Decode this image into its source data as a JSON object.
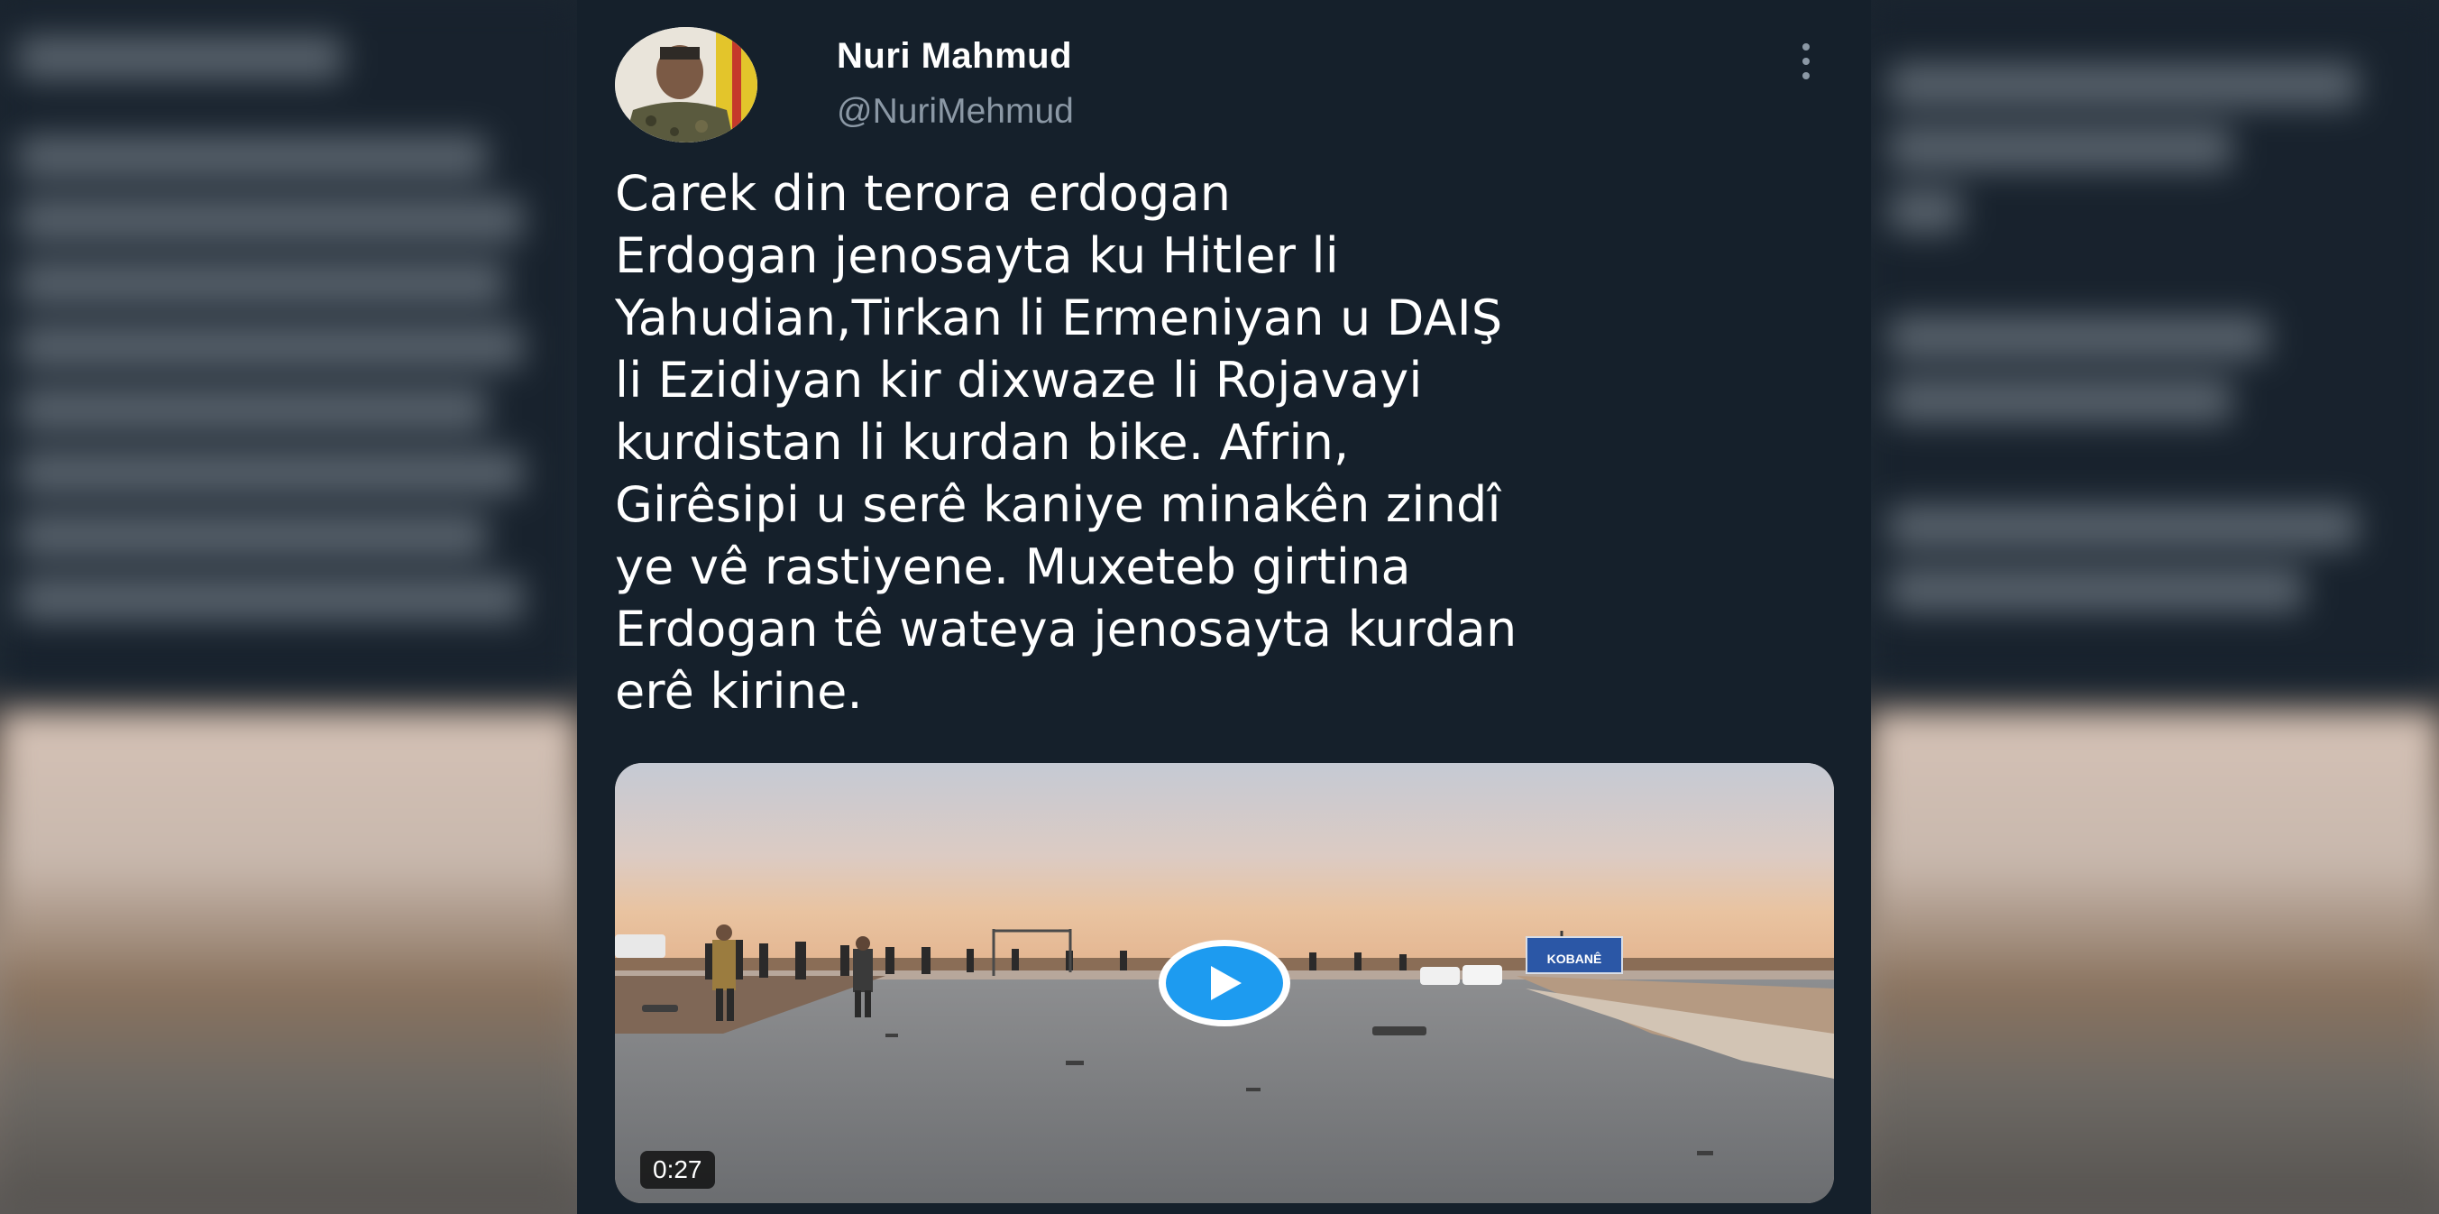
{
  "tweet": {
    "author": {
      "name": "Nuri Mahmud",
      "handle": "@NuriMehmud",
      "avatar_icon": "profile-photo"
    },
    "more_icon": "more-vertical-icon",
    "text": "Carek din terora erdogan\nErdogan jenosayta ku Hitler li\nYahudian,Tirkan li Ermeniyan u DAIŞ\nli Ezidiyan kir dixwaze li Rojavayi\nkurdistan li kurdan bike. Afrin,\nGirêsipi u serê kaniye minakên zindî\nye vê rastiyene. Muxeteb girtina\nErdogan tê wateya jenosayta kurdan\nerê kirine.",
    "video": {
      "duration": "0:27",
      "play_icon": "play-icon",
      "sign_text": "KOBANÊ"
    }
  },
  "colors": {
    "background": "#15202b",
    "text": "#ffffff",
    "secondary_text": "#8b98a5",
    "accent": "#1d9bf0"
  }
}
